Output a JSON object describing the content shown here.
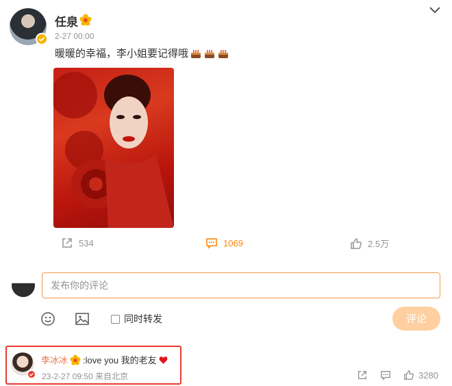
{
  "post": {
    "author": "任泉",
    "time": "2-27 00:00",
    "text": "暖暖的幸福，李小姐要记得哦",
    "emoji_count": 3,
    "image_alt": "portrait"
  },
  "actions": {
    "repost_count": "534",
    "comment_count": "1069",
    "like_count": "2.5万"
  },
  "composer": {
    "placeholder": "发布你的评论",
    "repost_label": "同时转发",
    "submit_label": "评论"
  },
  "comment": {
    "author": "李冰冰",
    "text": ":love you 我的老友",
    "meta": "23-2-27 09:50 来自北京",
    "like_count": "3280"
  },
  "colors": {
    "accent": "#ff8200",
    "comment_author": "#eb7350",
    "highlight_border": "#e8392f",
    "submit_bg": "#fecfa0"
  }
}
